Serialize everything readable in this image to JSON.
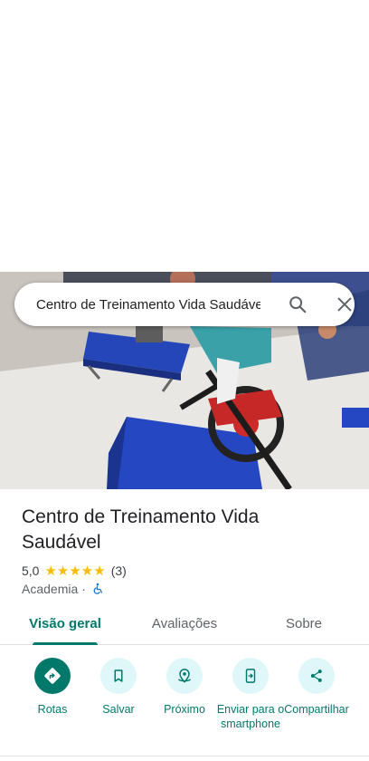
{
  "search": {
    "query": "Centro de Treinamento Vida Saudável"
  },
  "place": {
    "title_line1": "Centro de Treinamento Vida",
    "title_line2": "Saudável",
    "rating": "5,0",
    "stars": "★★★★★",
    "review_count": "(3)",
    "category": "Academia",
    "separator": "·",
    "accessibility_icon": "wheelchair-icon"
  },
  "tabs": [
    {
      "label": "Visão geral",
      "active": true
    },
    {
      "label": "Avaliações",
      "active": false
    },
    {
      "label": "Sobre",
      "active": false
    }
  ],
  "actions": [
    {
      "label": "Rotas",
      "icon": "directions-icon"
    },
    {
      "label": "Salvar",
      "icon": "bookmark-icon"
    },
    {
      "label": "Próximo",
      "icon": "nearby-icon"
    },
    {
      "label": "Enviar para o smartphone",
      "icon": "send-to-phone-icon"
    },
    {
      "label": "Compartilhar",
      "icon": "share-icon"
    }
  ],
  "colors": {
    "accent": "#00796b",
    "star": "#fbbc04",
    "action_bg": "#e0f7fa"
  }
}
